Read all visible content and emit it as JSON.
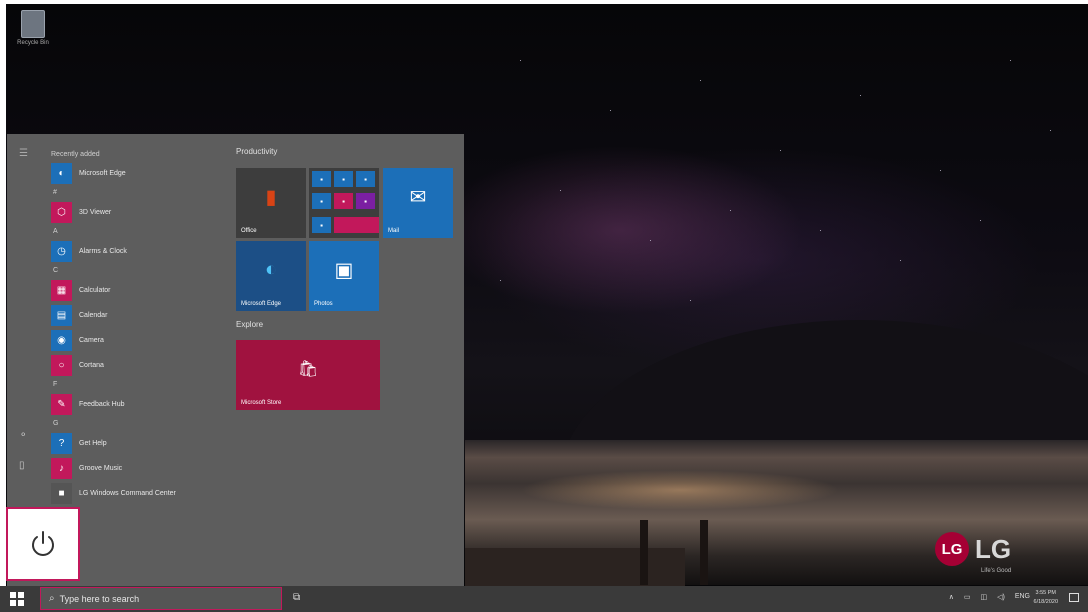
{
  "desktop": {
    "recycle_bin_label": "Recycle Bin",
    "brand": {
      "logo": "LG",
      "tagline": "Life's Good",
      "color": "#a50034"
    }
  },
  "start_menu": {
    "recently_added_label": "Recently added",
    "app_list": [
      {
        "type": "app",
        "label": "Microsoft Edge",
        "icon": "edge-icon",
        "color": "#1c6fb8"
      },
      {
        "type": "letter",
        "label": "#"
      },
      {
        "type": "app",
        "label": "3D Viewer",
        "icon": "cube-icon",
        "color": "#c2185b"
      },
      {
        "type": "letter",
        "label": "A"
      },
      {
        "type": "app",
        "label": "Alarms & Clock",
        "icon": "clock-icon",
        "color": "#1c6fb8"
      },
      {
        "type": "letter",
        "label": "C"
      },
      {
        "type": "app",
        "label": "Calculator",
        "icon": "calculator-icon",
        "color": "#c2185b"
      },
      {
        "type": "app",
        "label": "Calendar",
        "icon": "calendar-icon",
        "color": "#1c6fb8"
      },
      {
        "type": "app",
        "label": "Camera",
        "icon": "camera-icon",
        "color": "#1c6fb8"
      },
      {
        "type": "app",
        "label": "Cortana",
        "icon": "cortana-icon",
        "color": "#c2185b"
      },
      {
        "type": "letter",
        "label": "F"
      },
      {
        "type": "app",
        "label": "Feedback Hub",
        "icon": "feedback-icon",
        "color": "#c2185b"
      },
      {
        "type": "letter",
        "label": "G"
      },
      {
        "type": "app",
        "label": "Get Help",
        "icon": "help-icon",
        "color": "#1c6fb8"
      },
      {
        "type": "app",
        "label": "Groove Music",
        "icon": "music-icon",
        "color": "#c2185b"
      },
      {
        "type": "app",
        "label": "LG Windows Command Center",
        "icon": "lg-icon",
        "color": "#555"
      }
    ],
    "groups": {
      "productivity": "Productivity",
      "explore": "Explore"
    },
    "tiles": {
      "office": "Office",
      "mail": "Mail",
      "edge": "Microsoft Edge",
      "photos": "Photos",
      "store": "Microsoft Store"
    },
    "accent": "#c2185b"
  },
  "taskbar": {
    "search_placeholder": "Type here to search",
    "language": "ENG",
    "time": "3:55 PM",
    "date": "6/18/2020"
  }
}
